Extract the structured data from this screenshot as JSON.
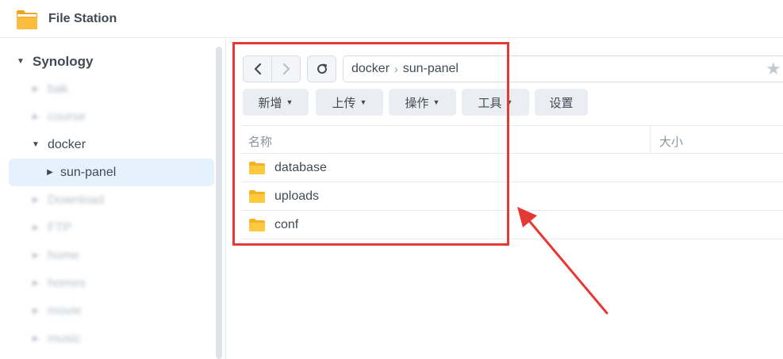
{
  "app": {
    "title": "File Station",
    "icon": "folder-app-icon"
  },
  "sidebar": {
    "root": "Synology",
    "items": [
      {
        "label": "bak",
        "blurred": true
      },
      {
        "label": "course",
        "blurred": true
      },
      {
        "label": "docker",
        "blurred": false,
        "expanded": true
      },
      {
        "label": "sun-panel",
        "blurred": false,
        "selected": true
      },
      {
        "label": "Download",
        "blurred": true
      },
      {
        "label": "FTP",
        "blurred": true
      },
      {
        "label": "home",
        "blurred": true
      },
      {
        "label": "homes",
        "blurred": true
      },
      {
        "label": "movie",
        "blurred": true
      },
      {
        "label": "music",
        "blurred": true
      }
    ]
  },
  "toolbar": {
    "path": [
      "docker",
      "sun-panel"
    ],
    "path_separator": "›",
    "buttons": {
      "create": "新增",
      "upload": "上传",
      "action": "操作",
      "tools": "工具",
      "settings": "设置"
    }
  },
  "list": {
    "columns": {
      "name": "名称",
      "size": "大小"
    },
    "rows": [
      {
        "name": "database",
        "type": "folder"
      },
      {
        "name": "uploads",
        "type": "folder"
      },
      {
        "name": "conf",
        "type": "folder"
      }
    ]
  },
  "colors": {
    "annotation": "#e53935",
    "selection": "#e5f2fd",
    "folder": "#f9c232",
    "text": "#414b55"
  }
}
